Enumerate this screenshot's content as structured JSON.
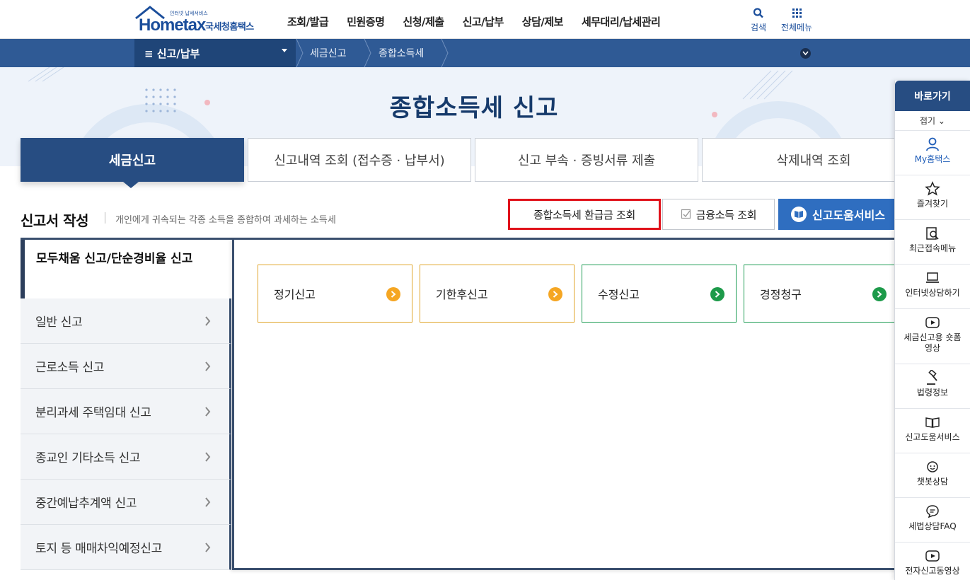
{
  "header": {
    "logo_text": "Hometax",
    "logo_tagline": "인터넷 납세서비스",
    "logo_org": "국세청홈택스",
    "gnb": [
      "조회/발급",
      "민원증명",
      "신청/제출",
      "신고/납부",
      "상담/제보",
      "세무대리/납세관리"
    ],
    "search_label": "검색",
    "all_menu_label": "전체메뉴"
  },
  "navbar": {
    "menu_label": "≡  신고/납부",
    "crumbs": [
      "세금신고",
      "종합소득세"
    ]
  },
  "hero": {
    "title": "종합소득세 신고"
  },
  "tabs": [
    {
      "label": "세금신고",
      "active": true
    },
    {
      "label": "신고내역 조회 (접수증 · 납부서)"
    },
    {
      "label": "신고 부속 · 증빙서류 제출"
    },
    {
      "label": "삭제내역 조회"
    }
  ],
  "section": {
    "title": "신고서 작성",
    "desc": "개인에게 귀속되는 각종 소득을 종합하여 과세하는 소득세",
    "refund_btn": "종합소득세 환급금 조회",
    "fin_btn": "금융소득 조회",
    "help_btn": "신고도움서비스"
  },
  "sidebar": {
    "active_label": "모두채움 신고/단순경비율 신고",
    "items": [
      "일반 신고",
      "근로소득 신고",
      "분리과세 주택임대 신고",
      "종교인 기타소득 신고",
      "중간예납추계액 신고",
      "토지 등 매매차익예정신고"
    ]
  },
  "cards": [
    {
      "label": "정기신고",
      "color": "#f5a623"
    },
    {
      "label": "기한후신고",
      "color": "#f5a623"
    },
    {
      "label": "수정신고",
      "color": "#1d9a4a"
    },
    {
      "label": "경정청구",
      "color": "#1d9a4a"
    }
  ],
  "quickbar": {
    "title": "바로가기",
    "fold": "접기 ⌄",
    "items": [
      "My홈택스",
      "즐겨찾기",
      "최근접속메뉴",
      "인터넷상담하기",
      "세금신고용 숏폼영상",
      "법령정보",
      "신고도움서비스",
      "챗봇상담",
      "세법상담FAQ",
      "전자신고동영상"
    ]
  },
  "colors": {
    "brand": "#274d82",
    "navbar": "#2f5a95",
    "highlight": "#e0121b",
    "help": "#2f6ec0"
  }
}
